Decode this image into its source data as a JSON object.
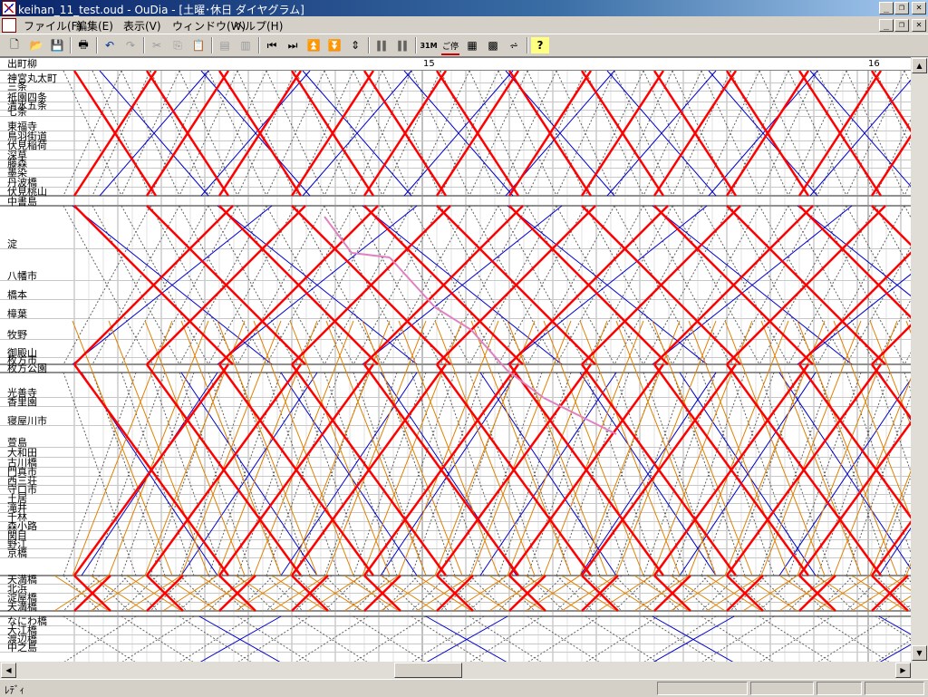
{
  "window": {
    "title": "keihan_11_test.oud - OuDia - [土曜･休日 ダイヤグラム]",
    "buttons": [
      "minimize",
      "restore",
      "close"
    ]
  },
  "menu": [
    "ファイル(F)",
    "編集(E)",
    "表示(V)",
    "ウィンドウ(W)",
    "ヘルプ(H)"
  ],
  "toolbar": {
    "icons": [
      "new-icon",
      "open-icon",
      "save-icon",
      "print-icon",
      "undo-icon",
      "redo-icon",
      "cut-icon",
      "copy-icon",
      "paste-icon",
      "insert-train-icon",
      "delete-train-icon",
      "first-icon",
      "last-icon",
      "top-icon",
      "bottom-icon",
      "fit-icon",
      "grid-icon",
      "min-icon",
      "stop-icon",
      "diagram-icon",
      "diagram2-icon",
      "diagram3-icon",
      "help-icon"
    ],
    "labels": {
      "min": "31M",
      "stop": "ご停"
    }
  },
  "diagram": {
    "time_labels": [
      "15",
      "16"
    ],
    "stations": [
      "出町柳",
      "神宮丸太町",
      "三条",
      "祇園四条",
      "清水五条",
      "七条",
      "東福寺",
      "鳥羽街道",
      "伏見稲荷",
      "深草",
      "藤森",
      "墨染",
      "丹波橋",
      "伏見桃山",
      "中書島",
      "淀",
      "八幡市",
      "橋本",
      "樟葉",
      "牧野",
      "御殿山",
      "枚方市",
      "枚方公園",
      "光善寺",
      "香里園",
      "寝屋川市",
      "萱島",
      "大和田",
      "古川橋",
      "門真市",
      "西三荘",
      "守口市",
      "土居",
      "滝井",
      "千林",
      "森小路",
      "関目",
      "野江",
      "京橋",
      "天満橋",
      "北浜",
      "淀屋橋",
      "天満橋",
      "なにわ橋",
      "大江橋",
      "渡辺橋",
      "中之島"
    ],
    "colors": {
      "express": "#ff0000",
      "local": "#0000cc",
      "semi": "#e08000",
      "special": "#e080c0",
      "dotted": "#606060"
    }
  },
  "status": {
    "text": "ﾚﾃﾞｨ"
  }
}
